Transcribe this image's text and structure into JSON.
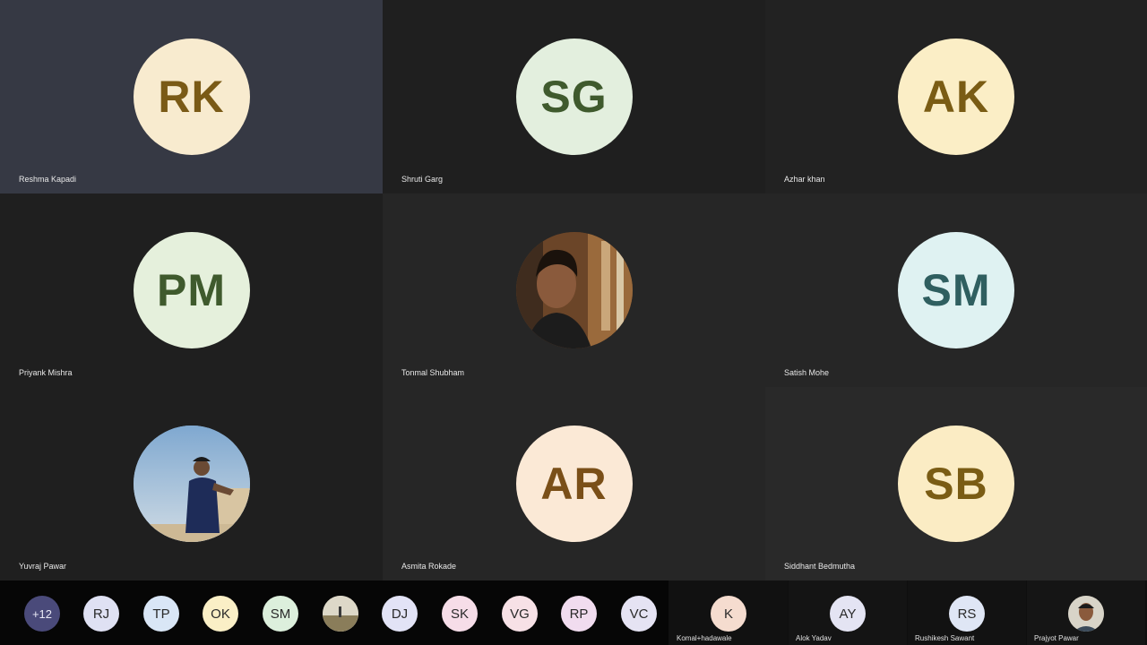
{
  "participants": [
    {
      "initials": "RK",
      "name": "Reshma Kapadi",
      "bg": "#f8ebcf",
      "fg": "#7a5a16",
      "tile": "active"
    },
    {
      "initials": "SG",
      "name": "Shruti Garg",
      "bg": "#e3efde",
      "fg": "#3f5a2d",
      "tile": "bg-b"
    },
    {
      "initials": "AK",
      "name": "Azhar khan",
      "bg": "#fbeec6",
      "fg": "#7a5c14",
      "tile": "bg-a"
    },
    {
      "initials": "PM",
      "name": "Priyank Mishra",
      "bg": "#e5f0dc",
      "fg": "#3f5a2d",
      "tile": "bg-b"
    },
    {
      "initials": "",
      "name": "Tonmal Shubham",
      "photo": "photo-indoor",
      "tile": "bg-c"
    },
    {
      "initials": "SM",
      "name": "Satish Mohe",
      "bg": "#dff2f2",
      "fg": "#2f5f60",
      "tile": "bg-c"
    },
    {
      "initials": "",
      "name": "Yuvraj Pawar",
      "photo": "photo-sky",
      "tile": "bg-b"
    },
    {
      "initials": "AR",
      "name": "Asmita Rokade",
      "bg": "#fbe9d6",
      "fg": "#7a4f18",
      "tile": "bg-c"
    },
    {
      "initials": "SB",
      "name": "Siddhant Bedmutha",
      "bg": "#fbecc4",
      "fg": "#7a5c14",
      "tile": "bg-d"
    }
  ],
  "strip": [
    {
      "label": "+12",
      "kind": "more"
    },
    {
      "label": "RJ",
      "bg": "#dfe1f3"
    },
    {
      "label": "TP",
      "bg": "#d9e6f6"
    },
    {
      "label": "OK",
      "bg": "#faefc6"
    },
    {
      "label": "SM",
      "bg": "#dcefdc"
    },
    {
      "label": "",
      "photo": "photo-landscape",
      "bg": "#c9c2b0"
    },
    {
      "label": "DJ",
      "bg": "#e2e3f6"
    },
    {
      "label": "SK",
      "bg": "#f6dde8"
    },
    {
      "label": "VG",
      "bg": "#f7e1e6"
    },
    {
      "label": "RP",
      "bg": "#f1dcef"
    },
    {
      "label": "VC",
      "bg": "#e5e3f3"
    }
  ],
  "cards": [
    {
      "initials": "K",
      "name": "Komal+hadawale",
      "bg": "#f5dccf"
    },
    {
      "initials": "AY",
      "name": "Alok Yadav",
      "bg": "#e4e4f3"
    },
    {
      "initials": "RS",
      "name": "Rushikesh Sawant",
      "bg": "#dfe6f5"
    },
    {
      "initials": "",
      "name": "Prajyot Pawar",
      "photo": "photo-self",
      "bg": "#8a8a7a"
    }
  ]
}
